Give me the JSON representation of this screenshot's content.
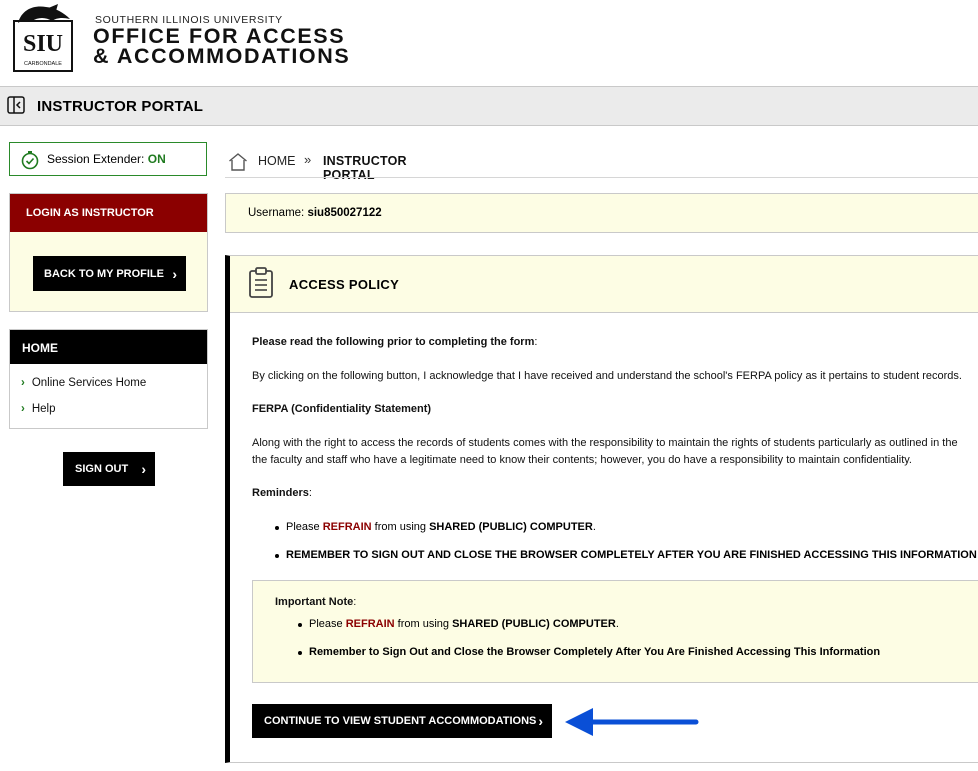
{
  "header": {
    "university": "SOUTHERN ILLINOIS UNIVERSITY",
    "office_line1": "OFFICE FOR ACCESS",
    "office_line2": "& ACCOMMODATIONS",
    "logo_text": "SIU",
    "logo_subtext": "CARBONDALE"
  },
  "topbar": {
    "title": "INSTRUCTOR PORTAL",
    "toggle_icon": "sidebar-toggle-icon"
  },
  "sidebar": {
    "session_label": "Session Extender:",
    "session_state": "ON",
    "login_header": "LOGIN AS INSTRUCTOR",
    "back_button": "BACK TO MY PROFILE",
    "home_header": "HOME",
    "nav_items": [
      {
        "label": "Online Services Home"
      },
      {
        "label": "Help"
      }
    ],
    "sign_out": "SIGN OUT"
  },
  "breadcrumb": {
    "home": "HOME",
    "current": "INSTRUCTOR PORTAL"
  },
  "user": {
    "label": "Username:",
    "value": "siu850027122"
  },
  "policy": {
    "title": "ACCESS POLICY",
    "intro_bold": "Please read the following prior to completing the form",
    "intro_colon": ":",
    "ack": "By clicking on the following button, I acknowledge that I have received and understand the school's FERPA policy as it pertains to student records.",
    "ferpa_title": "FERPA (Confidentiality Statement)",
    "ferpa_line1": "Along with the right to access the records of students comes with the responsibility to maintain the rights of students particularly as outlined in the",
    "ferpa_line2": "the faculty and staff who have a legitimate need to know their contents; however, you do have a responsibility to maintain confidentiality.",
    "reminders_label": "Reminders",
    "reminders_colon": ":",
    "bullet1_pre": "Please ",
    "bullet1_red": "REFRAIN",
    "bullet1_mid": " from using ",
    "bullet1_bold": "SHARED (PUBLIC) COMPUTER",
    "bullet1_end": ".",
    "bullet2": "REMEMBER TO SIGN OUT AND CLOSE THE BROWSER COMPLETELY AFTER YOU ARE FINISHED ACCESSING THIS INFORMATION",
    "note_title": "Important Note",
    "note_colon": ":",
    "note_bullet1_pre": "Please ",
    "note_bullet1_red": "REFRAIN",
    "note_bullet1_mid": " from using ",
    "note_bullet1_bold": "SHARED (PUBLIC) COMPUTER",
    "note_bullet1_end": ".",
    "note_bullet2": "Remember to Sign Out and Close the Browser Completely After You Are Finished Accessing This Information",
    "continue_button": "CONTINUE TO VIEW STUDENT ACCOMMODATIONS"
  },
  "colors": {
    "brand_red": "#8b0000",
    "accent_green": "#1f7a1f",
    "cream": "#fdfde4",
    "arrow_blue": "#0a4fd6"
  }
}
